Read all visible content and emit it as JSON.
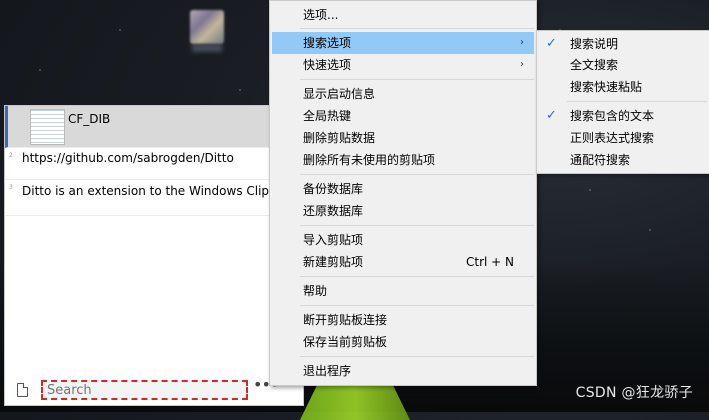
{
  "desktop": {
    "watermark": "CSDN @狂龙骄子"
  },
  "ditto": {
    "clips": [
      {
        "text": "CF_DIB",
        "selected": true,
        "index": "1"
      },
      {
        "text": "https://github.com/sabrogden/Ditto",
        "selected": false,
        "index": "2"
      },
      {
        "text": "Ditto is an extension to the Windows Clipboard",
        "selected": false,
        "index": "3"
      }
    ],
    "search": {
      "placeholder": "Search",
      "value": ""
    },
    "more_label": "•••"
  },
  "context_menu": {
    "items": [
      {
        "label": "选项..."
      },
      {
        "label": "搜索选项",
        "has_submenu": true,
        "highlighted": true
      },
      {
        "label": "快速选项",
        "has_submenu": true
      },
      {
        "label": "显示启动信息"
      },
      {
        "label": "全局热键"
      },
      {
        "label": "删除剪贴数据"
      },
      {
        "label": "删除所有未使用的剪贴项"
      },
      {
        "label": "备份数据库"
      },
      {
        "label": "还原数据库"
      },
      {
        "label": "导入剪贴项"
      },
      {
        "label": "新建剪贴项",
        "shortcut": "Ctrl + N"
      },
      {
        "label": "帮助"
      },
      {
        "label": "断开剪贴板连接"
      },
      {
        "label": "保存当前剪贴板"
      },
      {
        "label": "退出程序"
      }
    ],
    "arrow_glyph": "›",
    "check_glyph": "✓"
  },
  "search_submenu": {
    "items": [
      {
        "label": "搜索说明",
        "checked": true
      },
      {
        "label": "全文搜索",
        "checked": false
      },
      {
        "label": "搜索快速粘贴",
        "checked": false
      },
      {
        "label": "搜索包含的文本",
        "checked": true
      },
      {
        "label": "正则表达式搜索",
        "checked": false
      },
      {
        "label": "通配符搜索",
        "checked": false
      }
    ]
  }
}
